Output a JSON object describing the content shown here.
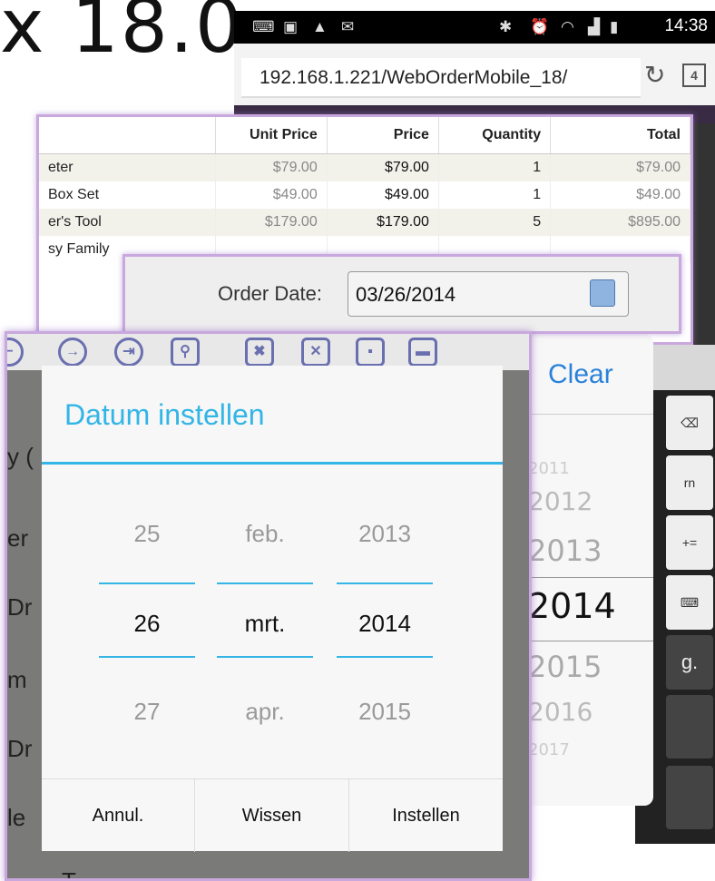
{
  "page_title": "x 18.0",
  "status_bar": {
    "time": "14:38"
  },
  "browser": {
    "url": "192.168.1.221/WebOrderMobile_18/",
    "tab_count": "4"
  },
  "order_table": {
    "columns": [
      "",
      "Unit Price",
      "Price",
      "Quantity",
      "Total"
    ],
    "rows": [
      {
        "name": "eter",
        "unit_price": "$79.00",
        "price": "$79.00",
        "quantity": "1",
        "total": "$79.00"
      },
      {
        "name": "Box Set",
        "unit_price": "$49.00",
        "price": "$49.00",
        "quantity": "1",
        "total": "$49.00"
      },
      {
        "name": "er's Tool",
        "unit_price": "$179.00",
        "price": "$179.00",
        "quantity": "5",
        "total": "$895.00"
      },
      {
        "name": "sy Family",
        "unit_price": "",
        "price": "",
        "quantity": "",
        "total": ""
      }
    ]
  },
  "order_date": {
    "label": "Order Date:",
    "value": "03/26/2014"
  },
  "ios_picker": {
    "clear_label": "Clear",
    "years": [
      "2011",
      "2012",
      "2013",
      "2014",
      "2015",
      "2016",
      "2017"
    ]
  },
  "keyboard": {
    "return_label": "rn",
    "symbols_label": "+=",
    "key_g": "g."
  },
  "form_fragments": [
    "y (",
    "er",
    "Dr",
    "m",
    "Dr",
    "le",
    "T"
  ],
  "android_dialog": {
    "title": "Datum instellen",
    "day": {
      "prev": "25",
      "current": "26",
      "next": "27"
    },
    "month": {
      "prev": "feb.",
      "current": "mrt.",
      "next": "apr."
    },
    "year": {
      "prev": "2013",
      "current": "2014",
      "next": "2015"
    },
    "buttons": {
      "cancel": "Annul.",
      "clear": "Wissen",
      "set": "Instellen"
    }
  },
  "colors": {
    "accent": "#33b5e5",
    "ios_blue": "#2a82d8",
    "highlight_border": "#c9a8de"
  }
}
